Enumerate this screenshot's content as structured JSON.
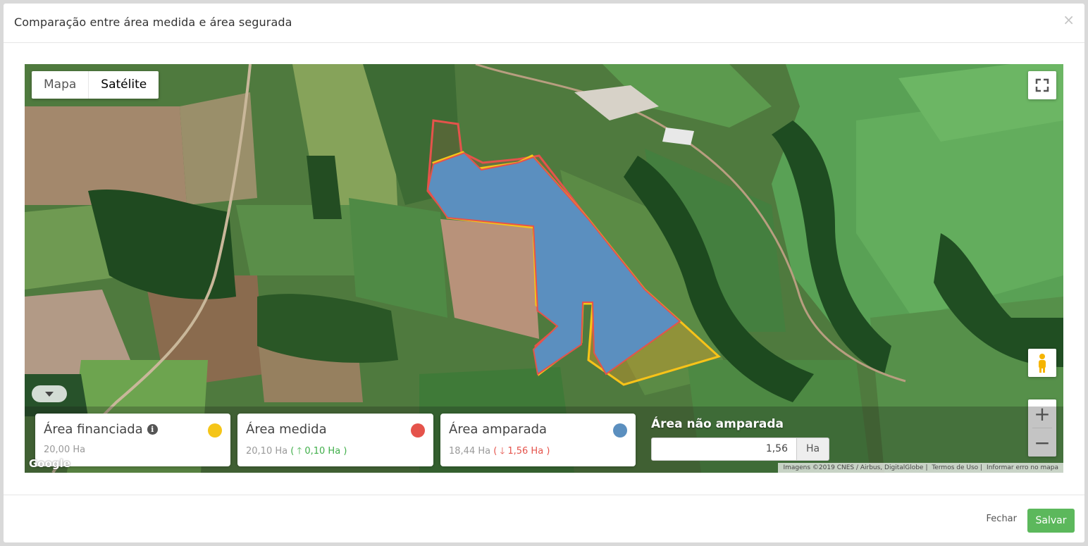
{
  "modal": {
    "title": "Comparação entre área medida e área segurada",
    "close_symbol": "×"
  },
  "map": {
    "type_buttons": [
      "Mapa",
      "Satélite"
    ],
    "active_type": "Satélite",
    "controls": {
      "fullscreen_icon": "fullscreen-icon",
      "pegman_icon": "pegman-icon",
      "zoom_in": "+",
      "zoom_out": "−"
    },
    "logo": "Google",
    "attribution": [
      "Imagens ©2019 CNES / Airbus, DigitalGlobe",
      "Termos de Uso",
      "Informar erro no mapa"
    ],
    "polygon_colors": {
      "financiada": "#f5c518",
      "medida": "#e5534b",
      "amparada": "#5b8fbf"
    }
  },
  "cards": [
    {
      "title": "Área financiada",
      "value": "20,00 Ha",
      "delta": "",
      "color": "#f5c518"
    },
    {
      "title": "Área medida",
      "value": "20,10 Ha",
      "delta_open": "(",
      "delta": "0,10 Ha",
      "delta_close": ")",
      "color": "#e5534b"
    },
    {
      "title": "Área amparada",
      "value": "18,44 Ha",
      "delta_open": "(",
      "delta": "1,56 Ha",
      "delta_close": ")",
      "color": "#5b8fbf"
    }
  ],
  "nao_amparada": {
    "title": "Área não amparada",
    "value": "1,56",
    "unit": "Ha"
  },
  "footer": {
    "close_label": "Fechar",
    "save_label": "Salvar"
  }
}
